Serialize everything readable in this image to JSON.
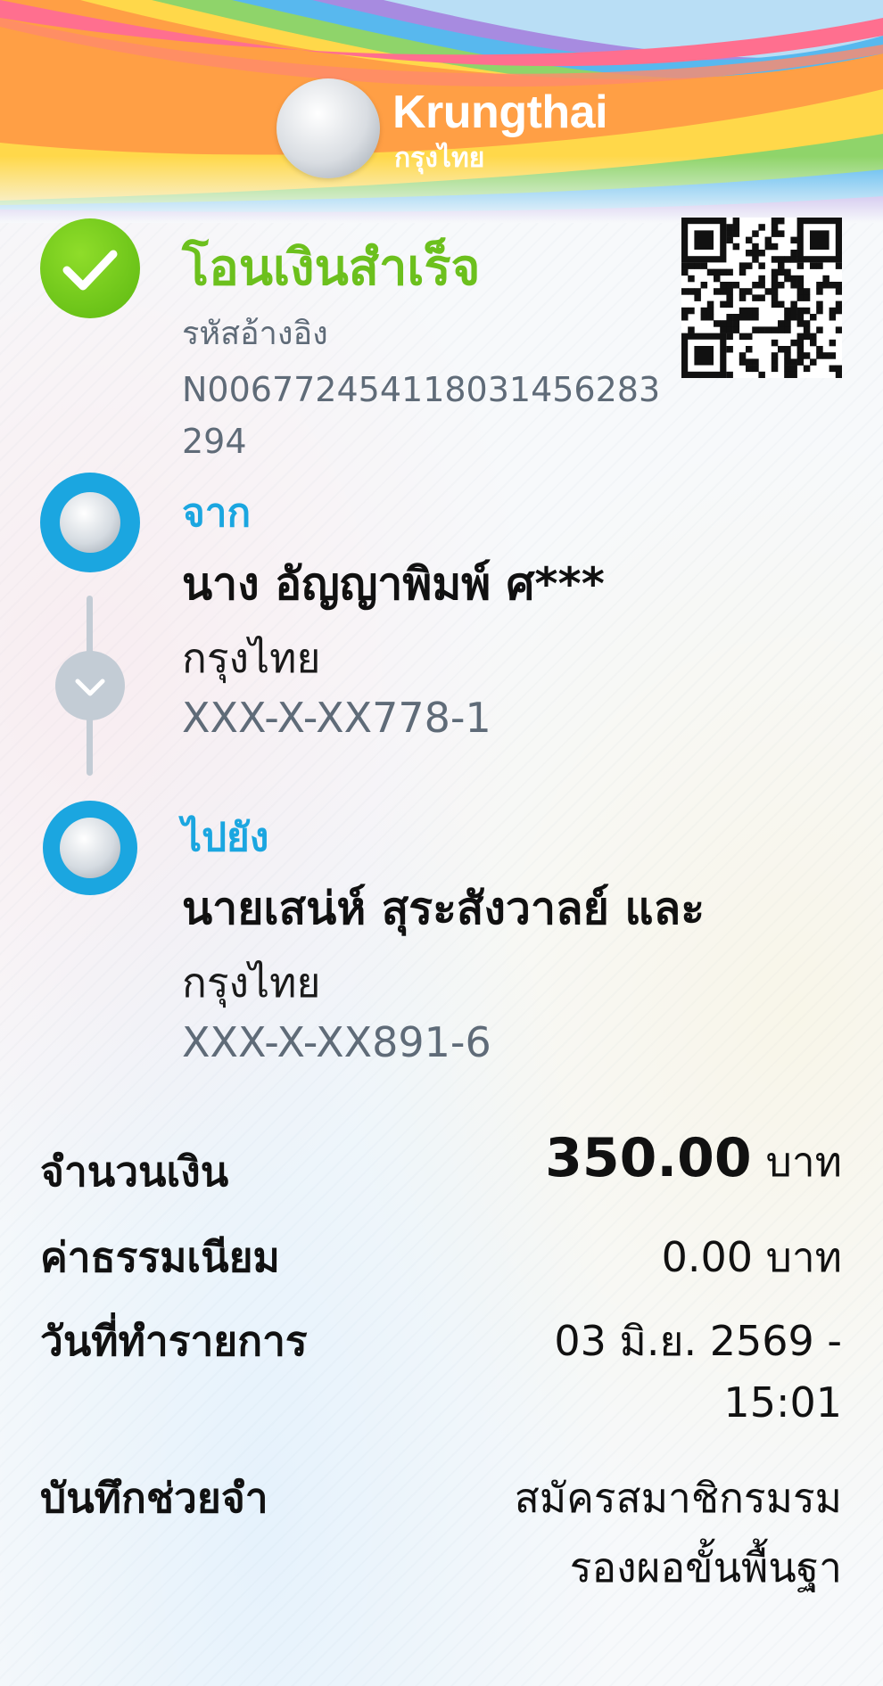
{
  "brand": {
    "name_en": "Krungthai",
    "name_th": "กรุงไทย",
    "colors": {
      "success": "#6cc01d",
      "accent": "#1ba6e0",
      "muted": "#5f6b78"
    }
  },
  "status": {
    "icon": "check-icon",
    "title": "โอนเงินสำเร็จ",
    "reference_label": "รหัสอ้างอิง",
    "reference_value": "N006772454118031456283294"
  },
  "from": {
    "label": "จาก",
    "name": "นาง อัญญาพิมพ์ ศ***",
    "bank": "กรุงไทย",
    "account": "XXX-X-XX778-1"
  },
  "to": {
    "label": "ไปยัง",
    "name": "นายเสน่ห์ สุระสังวาลย์ และ",
    "bank": "กรุงไทย",
    "account": "XXX-X-XX891-6"
  },
  "details": {
    "amount_label": "จำนวนเงิน",
    "amount_value": "350.00",
    "amount_unit": "บาท",
    "fee_label": "ค่าธรรมเนียม",
    "fee_value": "0.00 บาท",
    "date_label": "วันที่ทำรายการ",
    "date_line1": "03 มิ.ย. 2569 -",
    "date_line2": "15:01",
    "memo_label": "บันทึกช่วยจำ",
    "memo_line1": "สมัครสมาชิกรมรม",
    "memo_line2": "รองผอขั้นพื้นฐา"
  }
}
